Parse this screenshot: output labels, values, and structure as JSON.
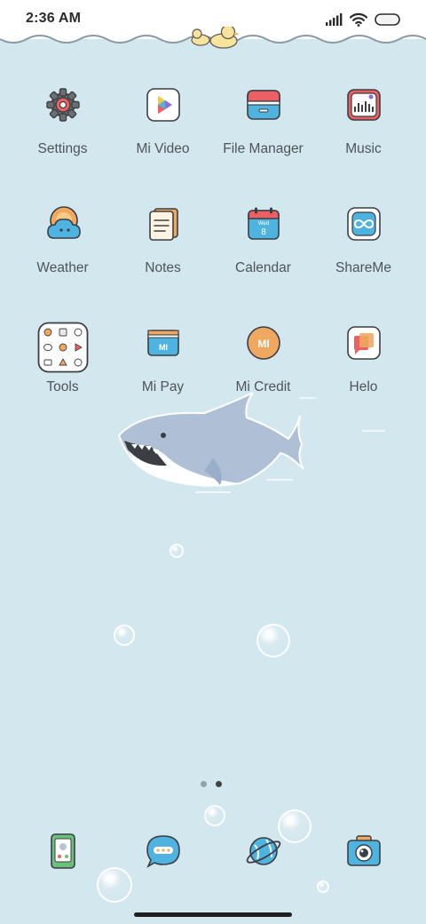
{
  "status_bar": {
    "time": "2:36 AM",
    "icons": [
      "signal-icon",
      "wifi-icon",
      "battery-icon"
    ]
  },
  "apps": [
    {
      "label": "Settings",
      "icon": "gear-icon"
    },
    {
      "label": "Mi Video",
      "icon": "play-icon"
    },
    {
      "label": "File Manager",
      "icon": "folder-icon"
    },
    {
      "label": "Music",
      "icon": "music-icon"
    },
    {
      "label": "Weather",
      "icon": "weather-icon"
    },
    {
      "label": "Notes",
      "icon": "notes-icon"
    },
    {
      "label": "Calendar",
      "icon": "calendar-icon"
    },
    {
      "label": "ShareMe",
      "icon": "shareme-icon"
    },
    {
      "label": "Tools",
      "icon": "tools-folder-icon"
    },
    {
      "label": "Mi Pay",
      "icon": "wallet-icon"
    },
    {
      "label": "Mi Credit",
      "icon": "mi-credit-icon"
    },
    {
      "label": "Helo",
      "icon": "helo-icon"
    }
  ],
  "calendar_icon": {
    "weekday": "Wed",
    "day": "8"
  },
  "mi_logo_text": "MI",
  "pages": {
    "count": 2,
    "current": 2
  },
  "dock": [
    {
      "name": "phone-icon"
    },
    {
      "name": "messages-icon"
    },
    {
      "name": "browser-icon"
    },
    {
      "name": "camera-icon"
    }
  ],
  "colors": {
    "wallpaper": "#d3e7ef",
    "label": "#4f5459",
    "outline": "#3b3f44",
    "accent_blue": "#4fb3df",
    "accent_red": "#ec5f62",
    "accent_orange": "#f0a860"
  }
}
